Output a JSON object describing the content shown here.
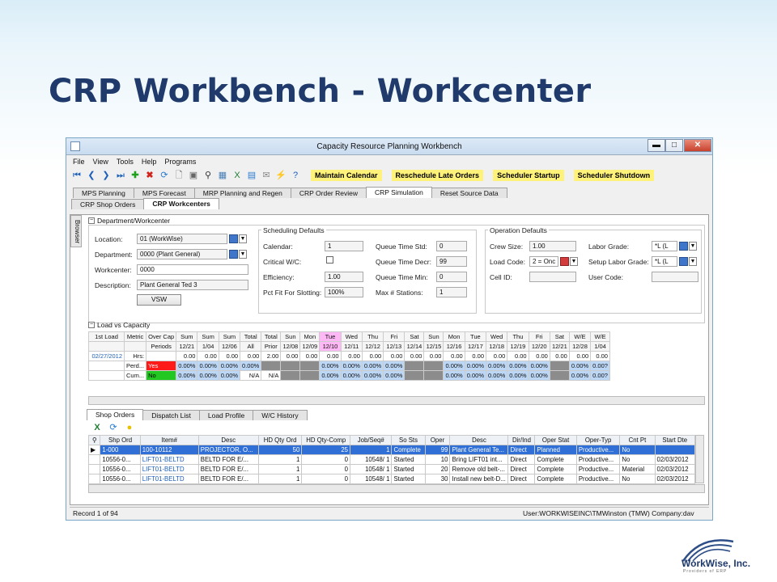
{
  "slide": {
    "title": "CRP Workbench - Workcenter"
  },
  "window": {
    "title": "Capacity Resource Planning Workbench",
    "min": "▬",
    "max": "□",
    "close": "✕"
  },
  "menu": [
    "File",
    "View",
    "Tools",
    "Help",
    "Programs"
  ],
  "toolbar": {
    "maintain_calendar": "Maintain Calendar",
    "reschedule_late_orders": "Reschedule Late Orders",
    "scheduler_startup": "Scheduler Startup",
    "scheduler_shutdown": "Scheduler Shutdown"
  },
  "tabs": [
    "MPS Planning",
    "MPS Forecast",
    "MRP Planning and Regen",
    "CRP Order Review",
    "CRP Simulation",
    "Reset Source Data"
  ],
  "subtabs": [
    "CRP Shop Orders",
    "CRP Workcenters"
  ],
  "browser_label": "Browser",
  "dept": {
    "header": "Department/Workcenter",
    "location_label": "Location:",
    "location": "01 (WorkWise)",
    "department_label": "Department:",
    "department": "0000 (Plant General)",
    "workcenter_label": "Workcenter:",
    "workcenter": "0000",
    "description_label": "Description:",
    "description": "Plant General Ted 3",
    "vsw": "VSW"
  },
  "sched": {
    "header": "Scheduling Defaults",
    "calendar_label": "Calendar:",
    "calendar": "1",
    "critical_label": "Critical W/C:",
    "efficiency_label": "Efficiency:",
    "efficiency": "1.00",
    "pct_label": "Pct Fit For Slotting:",
    "pct": "100%",
    "qstd_label": "Queue Time Std:",
    "qstd": "0",
    "qdecr_label": "Queue Time Decr:",
    "qdecr": "99",
    "qmin_label": "Queue Time Min:",
    "qmin": "0",
    "maxst_label": "Max # Stations:",
    "maxst": "1"
  },
  "ops": {
    "header": "Operation Defaults",
    "crew_label": "Crew Size:",
    "crew": "1.00",
    "loadcode_label": "Load Code:",
    "loadcode": "2 = Onc",
    "cell_label": "Cell ID:",
    "labor_label": "Labor Grade:",
    "labor": "*L (L",
    "setup_label": "Setup Labor Grade:",
    "setup": "*L (L",
    "user_label": "User Code:"
  },
  "load": {
    "header": "Load vs Capacity",
    "row1": [
      "1st Load",
      "Metric",
      "Over Cap",
      "Sum",
      "Sum",
      "Sum",
      "Total",
      "Total",
      "Sun",
      "Mon",
      "Tue",
      "Wed",
      "Thu",
      "Fri",
      "Sat",
      "Sun",
      "Mon",
      "Tue",
      "Wed",
      "Thu",
      "Fri",
      "Sat",
      "W/E",
      "W/E"
    ],
    "row2": [
      "",
      "",
      "Periods",
      "12/21",
      "1/04",
      "12/06",
      "All",
      "Prior",
      "12/08",
      "12/09",
      "12/10",
      "12/11",
      "12/12",
      "12/13",
      "12/14",
      "12/15",
      "12/16",
      "12/17",
      "12/18",
      "12/19",
      "12/20",
      "12/21",
      "12/28",
      "1/04"
    ],
    "date": "02/27/2012",
    "hrs": [
      "Hrs:",
      "",
      "0.00",
      "0.00",
      "0.00",
      "0.00",
      "2.00",
      "0.00",
      "0.00",
      "0.00",
      "0.00",
      "0.00",
      "0.00",
      "0.00",
      "0.00",
      "0.00",
      "0.00",
      "0.00",
      "0.00",
      "0.00",
      "0.00",
      "0.00",
      "0.00"
    ],
    "perd": [
      "Perd...",
      "Yes",
      "0.00%",
      "0.00%",
      "0.00%",
      "0.00%",
      "",
      "",
      "",
      "0.00%",
      "0.00%",
      "0.00%",
      "0.00%",
      "",
      "",
      "0.00%",
      "0.00%",
      "0.00%",
      "0.00%",
      "0.00%",
      "",
      "0.00%",
      "0.00?"
    ],
    "cum": [
      "Cum...",
      "No",
      "0.00%",
      "0.00%",
      "0.00%",
      "N/A",
      "N/A",
      "",
      "",
      "0.00%",
      "0.00%",
      "0.00%",
      "0.00%",
      "",
      "",
      "0.00%",
      "0.00%",
      "0.00%",
      "0.00%",
      "0.00%",
      "",
      "0.00%",
      "0.00?"
    ]
  },
  "bottom_tabs": [
    "Shop Orders",
    "Dispatch List",
    "Load Profile",
    "W/C History"
  ],
  "orders": {
    "headers": [
      "Shp Ord",
      "Item#",
      "Desc",
      "HD Qty Ord",
      "HD Qty-Comp",
      "Job/Seq#",
      "So Sts",
      "Oper",
      "Desc",
      "Dir/Ind",
      "Oper Stat",
      "Oper-Typ",
      "Cnt Pt",
      "Start Dte"
    ],
    "rows": [
      [
        "1-000",
        "100-10112",
        "PROJECTOR, O...",
        "50",
        "25",
        "1",
        "Complete",
        "99",
        "Plant General Te...",
        "Direct",
        "Planned",
        "Productive...",
        "No",
        ""
      ],
      [
        "10556-0...",
        "LIFT01-BELTD",
        "BELTD FOR E/...",
        "1",
        "0",
        "10548/  1",
        "Started",
        "10",
        "Bring LIFT01 int...",
        "Direct",
        "Complete",
        "Productive...",
        "No",
        "02/03/2012"
      ],
      [
        "10556-0...",
        "LIFT01-BELTD",
        "BELTD FOR E/...",
        "1",
        "0",
        "10548/  1",
        "Started",
        "20",
        "Remove old belt-...",
        "Direct",
        "Complete",
        "Productive...",
        "Material",
        "02/03/2012"
      ],
      [
        "10556-0...",
        "LIFT01-BELTD",
        "BELTD FOR E/...",
        "1",
        "0",
        "10548/  1",
        "Started",
        "30",
        "Install new belt-D...",
        "Direct",
        "Complete",
        "Productive...",
        "No",
        "02/03/2012"
      ]
    ]
  },
  "status": {
    "record": "Record 1 of 94",
    "user": "User:WORKWISEINC\\TMWinston (TMW) Company:dav"
  },
  "logo": {
    "name": "WorkWise, Inc.",
    "tagline": "Providers of ERP"
  },
  "colors": {
    "highlight": "#fff27a",
    "title": "#1f3a6b",
    "selected_row": "#2f6fd6",
    "red": "#ff1a1a",
    "green": "#22c722",
    "blue_cell": "#bcd7f6",
    "pink": "#ffb8f5"
  }
}
